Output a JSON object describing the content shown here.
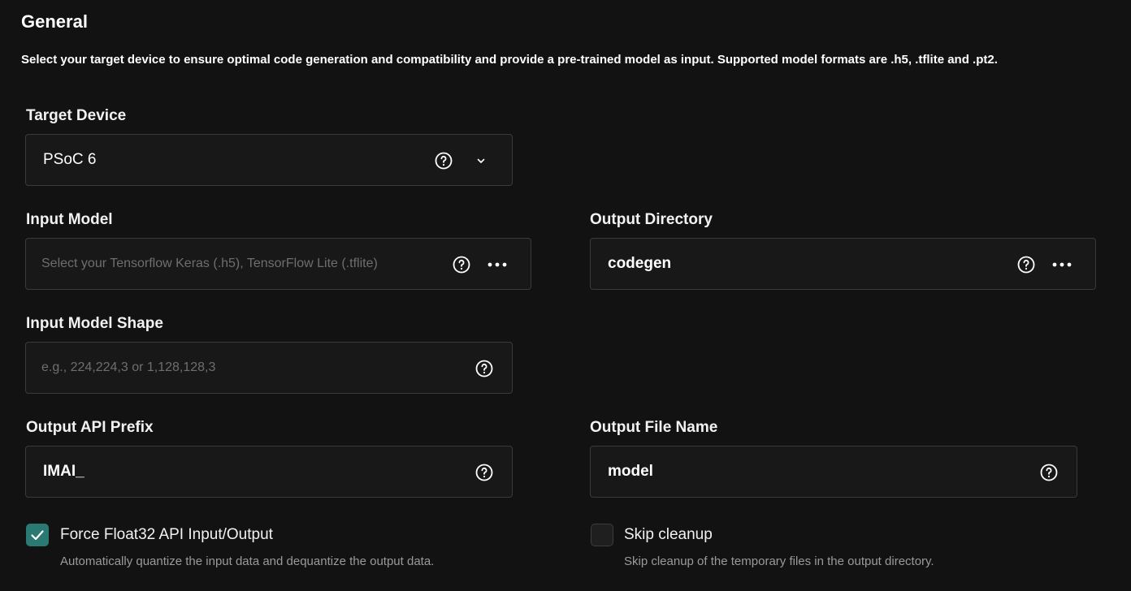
{
  "section": {
    "title": "General",
    "description": "Select your target device to ensure optimal code generation and compatibility and provide a pre-trained model as input. Supported model formats are .h5, .tflite and .pt2."
  },
  "target_device": {
    "label": "Target Device",
    "value": "PSoC 6"
  },
  "input_model": {
    "label": "Input Model",
    "placeholder": "Select your Tensorflow Keras (.h5), TensorFlow Lite (.tflite)"
  },
  "output_directory": {
    "label": "Output Directory",
    "value": "codegen"
  },
  "input_model_shape": {
    "label": "Input Model Shape",
    "placeholder": "e.g., 224,224,3 or 1,128,128,3"
  },
  "output_api_prefix": {
    "label": "Output API Prefix",
    "value": "IMAI_"
  },
  "output_file_name": {
    "label": "Output File Name",
    "value": "model"
  },
  "force_float32": {
    "label": "Force Float32 API Input/Output",
    "hint": "Automatically quantize the input data and dequantize the output data.",
    "checked": true
  },
  "skip_cleanup": {
    "label": "Skip cleanup",
    "hint": "Skip cleanup of the temporary files in the output directory.",
    "checked": false
  },
  "colors": {
    "background": "#121212",
    "field_background": "#181818",
    "field_border": "#3a3a3a",
    "checkbox_accent": "#2a7a73",
    "placeholder": "#6e6e6e",
    "hint": "#9a9a9a"
  },
  "icons": {
    "help": "help-circle-icon",
    "more": "more-horizontal-icon",
    "dropdown": "chevron-down-icon",
    "check": "check-icon"
  }
}
